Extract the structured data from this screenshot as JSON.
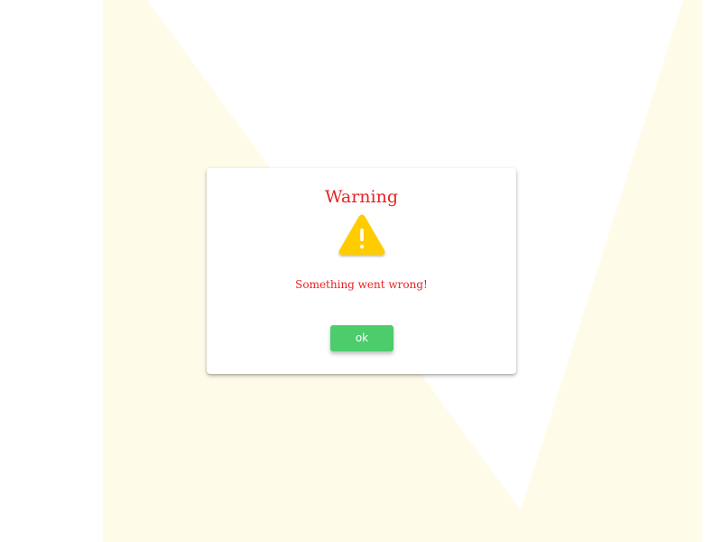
{
  "dialog": {
    "title": "Warning",
    "icon": "warning-triangle-icon",
    "message": "Something went wrong!",
    "ok_label": "ok"
  },
  "colors": {
    "background_tint": "#fffbe9",
    "title": "#e82224",
    "message": "#e82224",
    "icon_fill": "#ffcc00",
    "button": "#4ccc6b",
    "button_text": "#ffffff"
  }
}
